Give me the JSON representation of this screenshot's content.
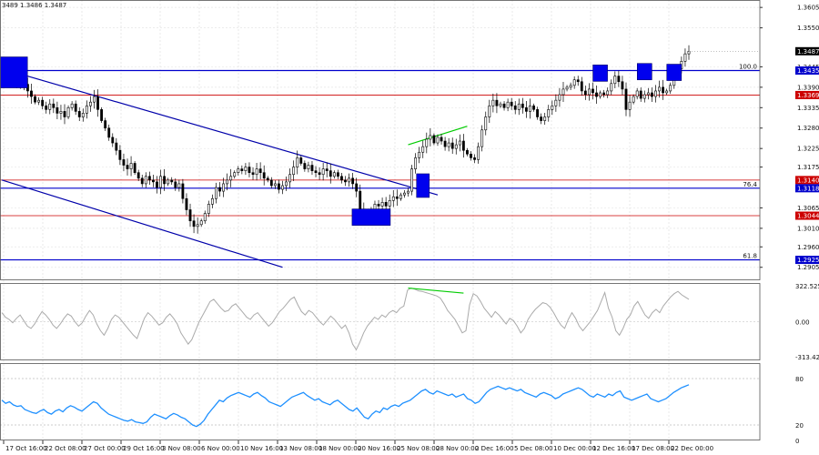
{
  "header": {
    "ohlc_text": "3489 1.3486 1.3487"
  },
  "chart_data": [
    {
      "type": "candlestick",
      "symbol_pair": "GBP/USD",
      "ylim": [
        1.287,
        1.3625
      ],
      "price_ticks": [
        "1.3605",
        "1.3550",
        "1.3445",
        "1.3390",
        "1.3335",
        "1.3280",
        "1.3225",
        "1.3175",
        "1.3065",
        "1.3010",
        "1.2960",
        "1.2905"
      ],
      "price_tick_values": [
        1.3605,
        1.355,
        1.3445,
        1.339,
        1.3335,
        1.328,
        1.3225,
        1.3175,
        1.3065,
        1.301,
        1.296,
        1.2905
      ],
      "last_price": {
        "label": "1.3487",
        "value": 1.3487
      },
      "levels": [
        {
          "label": "1.3435",
          "value": 1.3435,
          "color": "#0000cc",
          "fib": "100.0"
        },
        {
          "label": "1.3369",
          "value": 1.3369,
          "color": "#cc0000",
          "fib": ""
        },
        {
          "label": "1.3140",
          "value": 1.314,
          "color": "#cc0000",
          "fib": ""
        },
        {
          "label": "1.3118",
          "value": 1.3118,
          "color": "#0000cc",
          "fib": "76.4"
        },
        {
          "label": "1.3044",
          "value": 1.3044,
          "color": "#cc0000",
          "fib": ""
        },
        {
          "label": "1.2925",
          "value": 1.2925,
          "color": "#0000cc",
          "fib": "61.8"
        }
      ],
      "trendlines": [
        {
          "from": [
            0,
            1.344
          ],
          "to": [
            118,
            1.31
          ],
          "color": "#0000aa"
        },
        {
          "from": [
            0,
            1.314
          ],
          "to": [
            76,
            1.2905
          ],
          "color": "#0000aa"
        },
        {
          "from": [
            110,
            1.3235
          ],
          "to": [
            126,
            1.3285
          ],
          "color": "#00cc00"
        }
      ],
      "markers": [
        {
          "bar": 3,
          "value": 1.343,
          "color": "#0000ee"
        },
        {
          "bar": 100,
          "value": 1.304,
          "color": "#0000ee"
        },
        {
          "bar": 114,
          "value": 1.3125,
          "color": "#0000ee"
        },
        {
          "bar": 162,
          "value": 1.3428,
          "color": "#0000ee"
        },
        {
          "bar": 174,
          "value": 1.3432,
          "color": "#0000ee"
        },
        {
          "bar": 182,
          "value": 1.343,
          "color": "#0000ee"
        }
      ],
      "close_series": [
        1.3425,
        1.343,
        1.3435,
        1.3418,
        1.34,
        1.341,
        1.3398,
        1.338,
        1.3365,
        1.335,
        1.3355,
        1.334,
        1.333,
        1.3345,
        1.3335,
        1.332,
        1.3325,
        1.331,
        1.3335,
        1.3345,
        1.3325,
        1.331,
        1.332,
        1.334,
        1.335,
        1.3365,
        1.333,
        1.33,
        1.328,
        1.3255,
        1.324,
        1.322,
        1.3195,
        1.318,
        1.317,
        1.3185,
        1.316,
        1.3145,
        1.313,
        1.315,
        1.314,
        1.3135,
        1.312,
        1.315,
        1.313,
        1.314,
        1.3135,
        1.312,
        1.313,
        1.309,
        1.306,
        1.303,
        1.3015,
        1.302,
        1.303,
        1.305,
        1.3075,
        1.309,
        1.312,
        1.311,
        1.313,
        1.314,
        1.315,
        1.316,
        1.317,
        1.3165,
        1.3175,
        1.316,
        1.3155,
        1.317,
        1.316,
        1.3145,
        1.314,
        1.3125,
        1.313,
        1.3115,
        1.3125,
        1.3135,
        1.3155,
        1.3175,
        1.32,
        1.3185,
        1.317,
        1.318,
        1.3165,
        1.316,
        1.3155,
        1.317,
        1.3165,
        1.315,
        1.316,
        1.315,
        1.314,
        1.3135,
        1.3145,
        1.313,
        1.311,
        1.306,
        1.3045,
        1.305,
        1.306,
        1.3075,
        1.307,
        1.308,
        1.307,
        1.3085,
        1.3095,
        1.309,
        1.31,
        1.3105,
        1.311,
        1.317,
        1.32,
        1.3215,
        1.323,
        1.325,
        1.326,
        1.324,
        1.3255,
        1.3245,
        1.323,
        1.324,
        1.3225,
        1.3235,
        1.3245,
        1.322,
        1.321,
        1.32,
        1.3195,
        1.323,
        1.3275,
        1.331,
        1.334,
        1.3355,
        1.334,
        1.3345,
        1.3335,
        1.335,
        1.334,
        1.333,
        1.3345,
        1.3335,
        1.3325,
        1.334,
        1.333,
        1.331,
        1.33,
        1.331,
        1.333,
        1.334,
        1.3355,
        1.337,
        1.3385,
        1.339,
        1.3395,
        1.341,
        1.3405,
        1.338,
        1.337,
        1.3385,
        1.3375,
        1.3365,
        1.3375,
        1.337,
        1.338,
        1.34,
        1.342,
        1.3405,
        1.3385,
        1.333,
        1.335,
        1.3365,
        1.338,
        1.336,
        1.337,
        1.3375,
        1.3365,
        1.338,
        1.339,
        1.3375,
        1.338,
        1.3395,
        1.342,
        1.344,
        1.346,
        1.348,
        1.3487
      ]
    },
    {
      "type": "line",
      "indicator": "cci",
      "ylim": [
        -345,
        345
      ],
      "ticks": [
        "322.5258",
        "0.00",
        "-313.422"
      ],
      "tick_values": [
        322.5258,
        0,
        -313.422
      ],
      "color": "#aaaaaa",
      "divergence": {
        "from": [
          110,
          300
        ],
        "to": [
          125,
          255
        ],
        "color": "#00cc00"
      },
      "values": [
        80,
        40,
        20,
        -10,
        30,
        60,
        10,
        -40,
        -60,
        -20,
        40,
        90,
        60,
        20,
        -30,
        -60,
        -20,
        30,
        70,
        50,
        0,
        -40,
        -10,
        50,
        100,
        60,
        -20,
        -80,
        -120,
        -60,
        20,
        60,
        40,
        0,
        -40,
        -80,
        -120,
        -150,
        -60,
        30,
        80,
        50,
        10,
        -30,
        -10,
        40,
        70,
        30,
        -20,
        -100,
        -150,
        -200,
        -160,
        -80,
        0,
        60,
        120,
        180,
        200,
        160,
        120,
        90,
        100,
        140,
        160,
        120,
        80,
        40,
        20,
        60,
        80,
        40,
        0,
        -40,
        -10,
        40,
        90,
        120,
        160,
        200,
        220,
        150,
        90,
        60,
        100,
        80,
        40,
        0,
        -30,
        10,
        50,
        20,
        -20,
        -60,
        -30,
        -100,
        -200,
        -250,
        -180,
        -100,
        -40,
        0,
        40,
        20,
        60,
        40,
        80,
        100,
        80,
        120,
        140,
        280,
        300,
        290,
        275,
        270,
        260,
        250,
        240,
        230,
        210,
        160,
        100,
        60,
        20,
        -40,
        -100,
        -80,
        150,
        250,
        230,
        180,
        120,
        80,
        40,
        90,
        60,
        20,
        -20,
        30,
        10,
        -40,
        -100,
        -60,
        20,
        70,
        110,
        140,
        170,
        160,
        130,
        80,
        20,
        -30,
        -60,
        20,
        80,
        30,
        -40,
        -80,
        -40,
        0,
        50,
        100,
        180,
        260,
        120,
        40,
        -80,
        -120,
        -60,
        20,
        60,
        140,
        180,
        120,
        60,
        30,
        80,
        110,
        80,
        140,
        180,
        220,
        250,
        270,
        240,
        220,
        200
      ]
    },
    {
      "type": "line",
      "indicator": "rsi",
      "ylim": [
        0,
        100
      ],
      "ticks": [
        "80",
        "20",
        "0"
      ],
      "tick_values": [
        80,
        20,
        0
      ],
      "color": "#1e90ff",
      "values": [
        52,
        48,
        50,
        46,
        44,
        45,
        40,
        38,
        36,
        35,
        38,
        40,
        36,
        34,
        38,
        40,
        37,
        42,
        45,
        43,
        40,
        38,
        42,
        46,
        50,
        48,
        42,
        38,
        34,
        32,
        30,
        28,
        26,
        25,
        27,
        24,
        23,
        22,
        24,
        30,
        34,
        32,
        30,
        28,
        32,
        35,
        33,
        30,
        28,
        24,
        20,
        18,
        21,
        26,
        34,
        40,
        46,
        52,
        50,
        55,
        58,
        60,
        62,
        60,
        58,
        56,
        60,
        62,
        58,
        55,
        50,
        48,
        46,
        44,
        48,
        52,
        56,
        58,
        60,
        62,
        58,
        55,
        52,
        54,
        50,
        48,
        46,
        50,
        52,
        48,
        44,
        40,
        38,
        42,
        36,
        30,
        28,
        34,
        38,
        36,
        42,
        40,
        44,
        46,
        44,
        48,
        50,
        52,
        56,
        60,
        64,
        66,
        62,
        60,
        64,
        62,
        60,
        58,
        60,
        56,
        58,
        60,
        54,
        52,
        48,
        50,
        56,
        62,
        66,
        68,
        70,
        68,
        66,
        68,
        66,
        64,
        66,
        62,
        60,
        58,
        56,
        60,
        62,
        60,
        58,
        54,
        56,
        60,
        62,
        64,
        66,
        68,
        66,
        62,
        58,
        56,
        60,
        58,
        56,
        60,
        58,
        62,
        64,
        56,
        54,
        52,
        54,
        56,
        58,
        60,
        54,
        52,
        50,
        52,
        54,
        58,
        62,
        65,
        68,
        70,
        72
      ]
    }
  ],
  "time_axis": [
    "17 Oct 16:00",
    "22 Oct 08:00",
    "27 Oct 00:00",
    "29 Oct 16:00",
    "3 Nov 08:00",
    "6 Nov 00:00",
    "10 Nov 16:00",
    "13 Nov 08:00",
    "18 Nov 00:00",
    "20 Nov 16:00",
    "25 Nov 08:00",
    "28 Nov 00:00",
    "2 Dec 16:00",
    "5 Dec 08:00",
    "10 Dec 00:00",
    "12 Dec 16:00",
    "17 Dec 08:00",
    "22 Dec 00:00"
  ]
}
